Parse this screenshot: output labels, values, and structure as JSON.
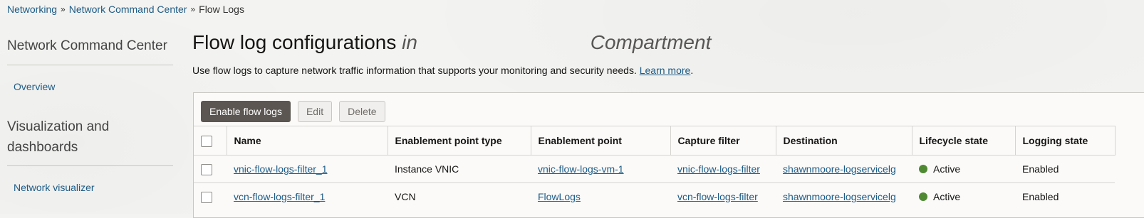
{
  "breadcrumb": {
    "items": [
      "Networking",
      "Network Command Center"
    ],
    "current": "Flow Logs",
    "separator": "»"
  },
  "sidebar": {
    "section1_title": "Network Command Center",
    "overview_link": "Overview",
    "section2_title": "Visualization and dashboards",
    "network_visualizer_link": "Network visualizer"
  },
  "page": {
    "title": "Flow log configurations",
    "title_in": "in",
    "title_compartment": "Compartment",
    "description": "Use flow logs to capture network traffic information that supports your monitoring and security needs.",
    "learn_more": "Learn more",
    "description_end": "."
  },
  "toolbar": {
    "enable_label": "Enable flow logs",
    "edit_label": "Edit",
    "delete_label": "Delete"
  },
  "table": {
    "columns": [
      "Name",
      "Enablement point type",
      "Enablement point",
      "Capture filter",
      "Destination",
      "Lifecycle state",
      "Logging state"
    ],
    "rows": [
      {
        "name": "vnic-flow-logs-filter_1",
        "type": "Instance VNIC",
        "point": "vnic-flow-logs-vm-1",
        "filter": "vnic-flow-logs-filter",
        "destination": "shawnmoore-logservicelg",
        "lifecycle": "Active",
        "logging": "Enabled"
      },
      {
        "name": "vcn-flow-logs-filter_1",
        "type": "VCN",
        "point": "FlowLogs",
        "filter": "vcn-flow-logs-filter",
        "destination": "shawnmoore-logservicelg",
        "lifecycle": "Active",
        "logging": "Enabled"
      }
    ]
  },
  "colors": {
    "link": "#1c5b86",
    "primary_button": "#5b5652",
    "active_status": "#4f8a32"
  }
}
